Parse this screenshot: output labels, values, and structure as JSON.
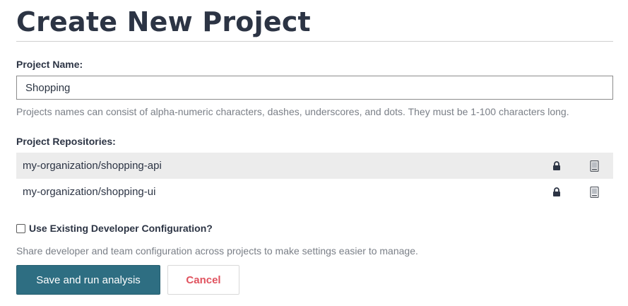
{
  "header": {
    "title": "Create New Project"
  },
  "project_name": {
    "label": "Project Name:",
    "value": "Shopping",
    "hint": "Projects names can consist of alpha-numeric characters, dashes, underscores, and dots. They must be 1-100 characters long."
  },
  "repositories": {
    "label": "Project Repositories:",
    "items": [
      {
        "name": "my-organization/shopping-api",
        "lock_icon": "lock-icon",
        "device_icon": "device-icon"
      },
      {
        "name": "my-organization/shopping-ui",
        "lock_icon": "lock-icon",
        "device_icon": "device-icon"
      }
    ]
  },
  "developer_config": {
    "checkbox_label": "Use Existing Developer Configuration?",
    "checked": false,
    "hint": "Share developer and team configuration across projects to make settings easier to manage."
  },
  "actions": {
    "save_label": "Save and run analysis",
    "cancel_label": "Cancel"
  },
  "colors": {
    "title": "#2c3444",
    "primary_button": "#2e6e82",
    "cancel_text": "#e0525e",
    "row_stripe": "#ececec"
  }
}
